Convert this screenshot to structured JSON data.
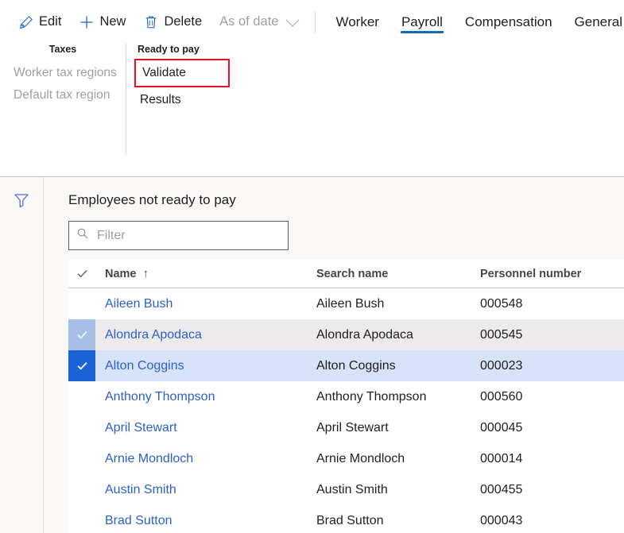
{
  "toolbar": {
    "buttons": [
      {
        "label": "Edit",
        "icon": "pencil-icon",
        "disabled": false,
        "chevron": false
      },
      {
        "label": "New",
        "icon": "plus-icon",
        "disabled": false,
        "chevron": false
      },
      {
        "label": "Delete",
        "icon": "trash-icon",
        "disabled": false,
        "chevron": false
      },
      {
        "label": "As of date",
        "icon": "none",
        "disabled": true,
        "chevron": true
      }
    ]
  },
  "tabs": [
    {
      "label": "Worker",
      "active": false
    },
    {
      "label": "Payroll",
      "active": true
    },
    {
      "label": "Compensation",
      "active": false
    },
    {
      "label": "General",
      "active": false
    }
  ],
  "groups": [
    {
      "title": "Taxes",
      "title_align": "center",
      "items": [
        {
          "label": "Worker tax regions",
          "disabled": true,
          "highlight": false
        },
        {
          "label": "Default tax region",
          "disabled": true,
          "highlight": false
        }
      ]
    },
    {
      "title": "Ready to pay",
      "title_align": "left",
      "items": [
        {
          "label": "Validate",
          "disabled": false,
          "highlight": true
        },
        {
          "label": "Results",
          "disabled": false,
          "highlight": false
        }
      ]
    }
  ],
  "panel": {
    "title": "Employees not ready to pay",
    "filter_placeholder": "Filter",
    "filter_value": ""
  },
  "grid": {
    "columns": [
      {
        "key": "check",
        "label": ""
      },
      {
        "key": "name",
        "label": "Name",
        "sort": "↑"
      },
      {
        "key": "search",
        "label": "Search name"
      },
      {
        "key": "pers",
        "label": "Personnel number"
      }
    ],
    "rows": [
      {
        "name": "Aileen Bush",
        "search": "Aileen Bush",
        "pers": "000548",
        "state": "none"
      },
      {
        "name": "Alondra Apodaca",
        "search": "Alondra Apodaca",
        "pers": "000545",
        "state": "hovered"
      },
      {
        "name": "Alton Coggins",
        "search": "Alton Coggins",
        "pers": "000023",
        "state": "selected"
      },
      {
        "name": "Anthony Thompson",
        "search": "Anthony Thompson",
        "pers": "000560",
        "state": "none"
      },
      {
        "name": "April Stewart",
        "search": "April Stewart",
        "pers": "000045",
        "state": "none"
      },
      {
        "name": "Arnie Mondloch",
        "search": "Arnie Mondloch",
        "pers": "000014",
        "state": "none"
      },
      {
        "name": "Austin Smith",
        "search": "Austin Smith",
        "pers": "000455",
        "state": "none"
      },
      {
        "name": "Brad Sutton",
        "search": "Brad Sutton",
        "pers": "000043",
        "state": "none"
      }
    ]
  },
  "colors": {
    "accent": "#0f6cbd",
    "link": "#2b5fcc",
    "selected_row": "#d7e3f8",
    "hover_row": "#eceaea",
    "checkbox_checked": "#1b62d4",
    "checkbox_partial": "#a7bfe6",
    "highlight_outline": "#e81123",
    "disabled_text": "#a19f9d"
  }
}
